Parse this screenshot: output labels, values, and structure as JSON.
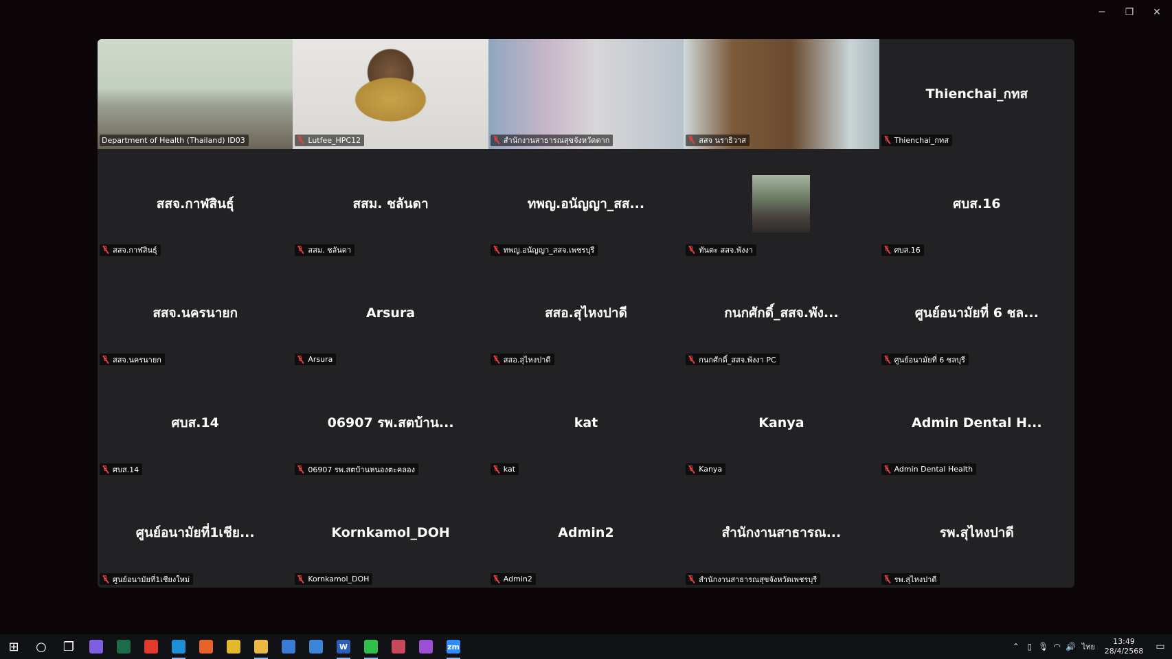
{
  "window": {
    "controls": {
      "minimize": "─",
      "restore": "❐",
      "close": "✕"
    }
  },
  "tiles": [
    {
      "name": "",
      "label": "Department of Health (Thailand) ID03",
      "video": "office",
      "active": true,
      "mic_muted": false
    },
    {
      "name": "",
      "label": "Lutfee_HPC12",
      "video": "person",
      "mic_muted": true
    },
    {
      "name": "",
      "label": "สำนักงานสาธารณสุขจังหวัดตาก",
      "video": "meeting",
      "mic_muted": true
    },
    {
      "name": "",
      "label": "สสจ นราธิวาส",
      "video": "room",
      "mic_muted": true
    },
    {
      "name": "Thienchai_กทส",
      "label": "Thienchai_กทส",
      "mic_muted": true
    },
    {
      "name": "สสจ.กาฬสินธุ์",
      "label": "สสจ.กาฬสินธุ์",
      "mic_muted": true
    },
    {
      "name": "สสม. ชลันดา",
      "label": "สสม. ชลันดา",
      "mic_muted": true
    },
    {
      "name": "ทพญ.อนัญญา_สส...",
      "label": "ทพญ.อนัญญา_สสจ.เพชรบุรี",
      "mic_muted": true
    },
    {
      "name": "",
      "label": "ทันตะ สสจ.พังงา",
      "photo": "profile-photo",
      "mic_muted": true
    },
    {
      "name": "ศบส.16",
      "label": "ศบส.16",
      "mic_muted": true
    },
    {
      "name": "สสจ.นครนายก",
      "label": "สสจ.นครนายก",
      "mic_muted": true
    },
    {
      "name": "Arsura",
      "label": "Arsura",
      "mic_muted": true
    },
    {
      "name": "สสอ.สุไหงปาดี",
      "label": "สสอ.สุไหงปาดี",
      "mic_muted": true
    },
    {
      "name": "กนกศักดิ์_สสจ.พัง...",
      "label": "กนกศักดิ์_สสจ.พังงา PC",
      "mic_muted": true
    },
    {
      "name": "ศูนย์อนามัยที่ 6 ชล...",
      "label": "ศูนย์อนามัยที่ 6 ชลบุรี",
      "mic_muted": true
    },
    {
      "name": "ศบส.14",
      "label": "ศบส.14",
      "mic_muted": true
    },
    {
      "name": "06907 รพ.สตบ้าน...",
      "label": "06907 รพ.สตบ้านหนองตะคลอง",
      "mic_muted": true
    },
    {
      "name": "kat",
      "label": "kat",
      "mic_muted": true
    },
    {
      "name": "Kanya",
      "label": "Kanya",
      "mic_muted": true
    },
    {
      "name": "Admin Dental H...",
      "label": "Admin Dental Health",
      "mic_muted": true
    },
    {
      "name": "ศูนย์อนามัยที่1เชีย...",
      "label": "ศูนย์อนามัยที่1เชียงใหม่",
      "mic_muted": true
    },
    {
      "name": "Kornkamol_DOH",
      "label": "Kornkamol_DOH",
      "mic_muted": true
    },
    {
      "name": "Admin2",
      "label": "Admin2",
      "mic_muted": true
    },
    {
      "name": "สำนักงานสาธารณ...",
      "label": "สำนักงานสาธารณสุขจังหวัดเพชรบุรี",
      "mic_muted": true
    },
    {
      "name": "รพ.สุไหงปาดี",
      "label": "รพ.สุไหงปาดี",
      "mic_muted": true
    }
  ],
  "taskbar": {
    "apps": [
      {
        "icon": "start-icon",
        "glyph": "⊞",
        "color": "#101215"
      },
      {
        "icon": "search-icon",
        "glyph": "○",
        "color": "#101215"
      },
      {
        "icon": "task-view-icon",
        "glyph": "❐",
        "color": "#101215"
      },
      {
        "icon": "copilot-icon",
        "glyph": "",
        "color": "#7d5fe0"
      },
      {
        "icon": "app-green-icon",
        "glyph": "",
        "color": "#1e6b4a"
      },
      {
        "icon": "anydesk-icon",
        "glyph": "",
        "color": "#e23b2e"
      },
      {
        "icon": "edge-icon",
        "glyph": "",
        "color": "#1d8fd6",
        "running": true
      },
      {
        "icon": "firefox-icon",
        "glyph": "",
        "color": "#e8632a"
      },
      {
        "icon": "chrome-icon",
        "glyph": "",
        "color": "#e0b92d"
      },
      {
        "icon": "file-explorer-icon",
        "glyph": "",
        "color": "#e8b840",
        "running": true
      },
      {
        "icon": "store-icon",
        "glyph": "",
        "color": "#3a7bd5"
      },
      {
        "icon": "mail-icon",
        "glyph": "",
        "color": "#3b86d8"
      },
      {
        "icon": "word-icon",
        "glyph": "W",
        "color": "#2b5fb8",
        "running": true
      },
      {
        "icon": "line-icon",
        "glyph": "",
        "color": "#2fbf4a",
        "running": true
      },
      {
        "icon": "chrome-profile-icon",
        "glyph": "",
        "color": "#c84a5a"
      },
      {
        "icon": "app-purple-icon",
        "glyph": "",
        "color": "#9b4fd4"
      },
      {
        "icon": "zoom-icon",
        "glyph": "zm",
        "color": "#2d8cff",
        "running": true
      }
    ],
    "tray": {
      "language": "ไทย",
      "time": "13:49",
      "date": "28/4/2568"
    }
  }
}
